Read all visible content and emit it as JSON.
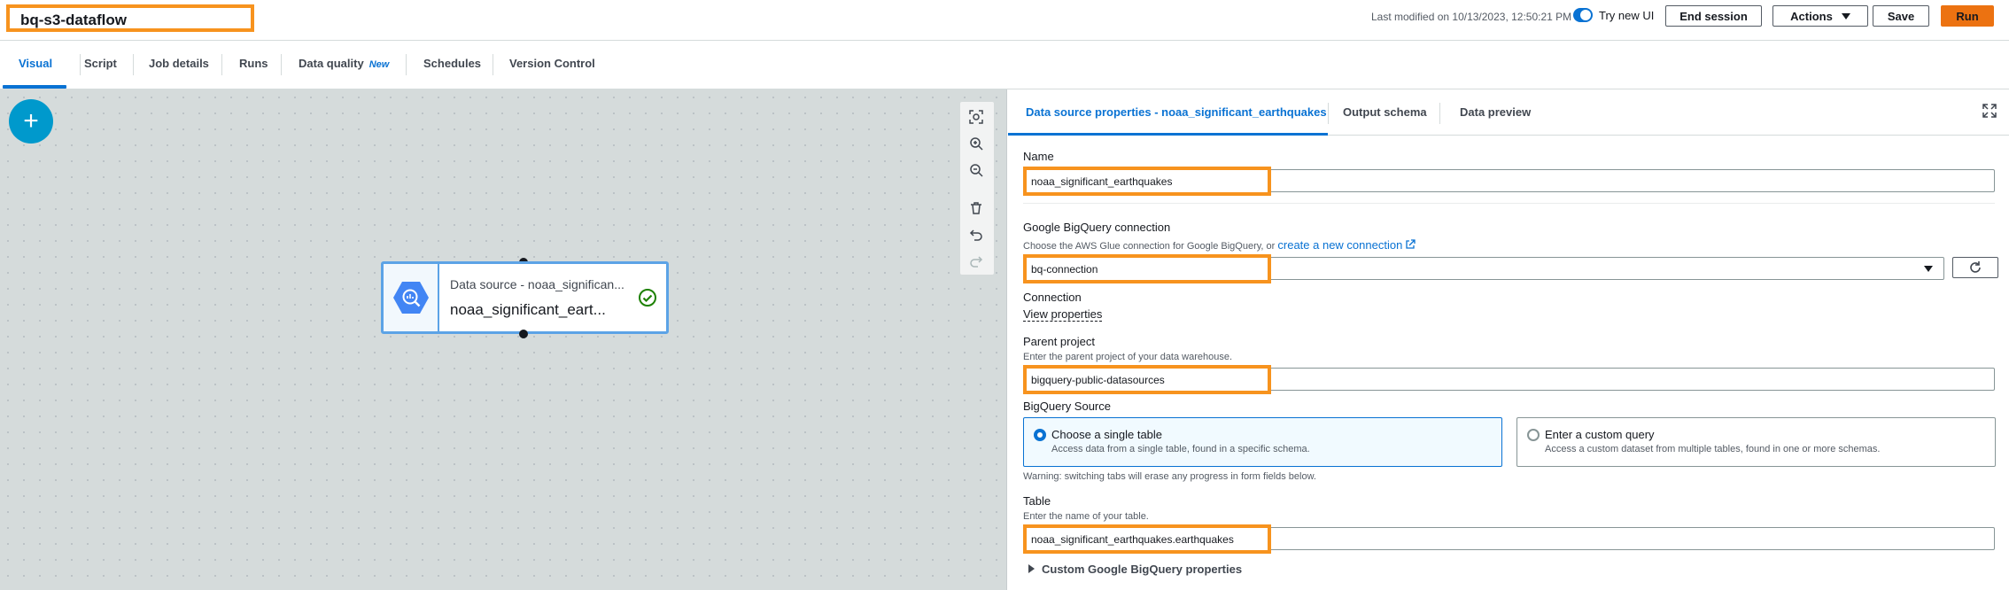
{
  "header": {
    "job_title": "bq-s3-dataflow",
    "last_modified": "Last modified on 10/13/2023, 12:50:21 PM",
    "toggle_label": "Try new UI",
    "end_session": "End session",
    "actions": "Actions",
    "save": "Save",
    "run": "Run"
  },
  "tabs": [
    {
      "label": "Visual"
    },
    {
      "label": "Script"
    },
    {
      "label": "Job details"
    },
    {
      "label": "Runs"
    },
    {
      "label": "Data quality",
      "badge": "New"
    },
    {
      "label": "Schedules"
    },
    {
      "label": "Version Control"
    }
  ],
  "canvas": {
    "add_label": "+",
    "node": {
      "title": "Data source - noaa_significan...",
      "name": "noaa_significant_eart...",
      "icon": "bigquery-icon",
      "status_icon": "check-circle-icon"
    }
  },
  "panel": {
    "tabs": [
      {
        "label": "Data source properties - noaa_significant_earthquakes"
      },
      {
        "label": "Output schema"
      },
      {
        "label": "Data preview"
      }
    ],
    "name_label": "Name",
    "name_value": "noaa_significant_earthquakes",
    "connection_label": "Google BigQuery connection",
    "connection_desc": "Choose the AWS Glue connection for Google BigQuery, or",
    "connection_link": "create a new connection",
    "connection_value": "bq-connection",
    "connection_sub_label": "Connection",
    "view_properties": "View properties",
    "parent_label": "Parent project",
    "parent_desc": "Enter the parent project of your data warehouse.",
    "parent_value": "bigquery-public-datasources",
    "source_label": "BigQuery Source",
    "option_a_title": "Choose a single table",
    "option_a_desc": "Access data from a single table, found in a specific schema.",
    "option_b_title": "Enter a custom query",
    "option_b_desc": "Access a custom dataset from multiple tables, found in one or more schemas.",
    "warning": "Warning: switching tabs will erase any progress in form fields below.",
    "table_label": "Table",
    "table_desc": "Enter the name of your table.",
    "table_value": "noaa_significant_earthquakes.earthquakes",
    "custom_props": "Custom Google BigQuery properties"
  },
  "colors": {
    "accent": "#0972d3",
    "highlight": "#f7931e",
    "run_button": "#ec7211",
    "canvas_bg": "#d5dbdb",
    "success": "#1d8102"
  }
}
